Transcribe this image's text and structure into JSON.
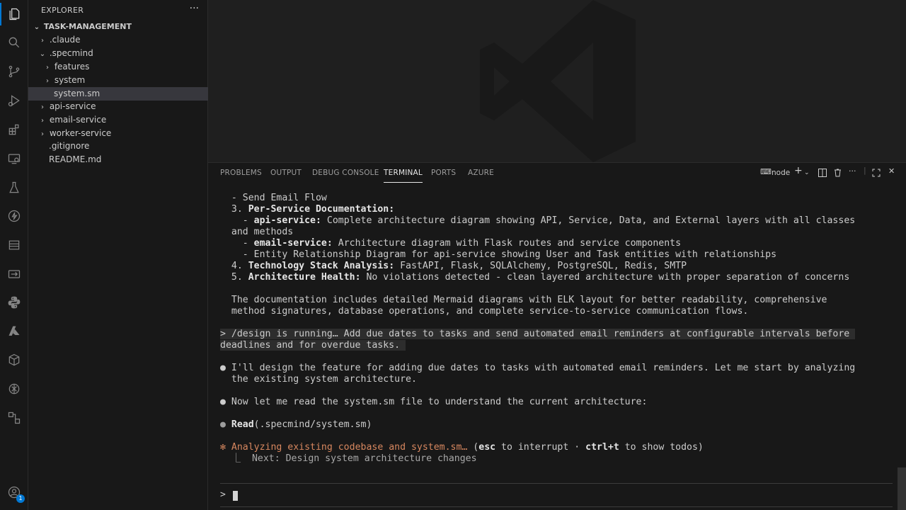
{
  "activity_bar": {
    "icons": [
      "files-icon",
      "search-icon",
      "source-control-icon",
      "run-debug-icon",
      "extensions-icon",
      "remote-explorer-icon",
      "testing-icon",
      "lightning-icon",
      "docker-icon",
      "remote-icon",
      "python-icon",
      "azure-icon",
      "package-icon",
      "openai-icon",
      "diagram-icon",
      "account-icon"
    ],
    "account_badge": "1"
  },
  "explorer": {
    "title": "EXPLORER",
    "more": "···",
    "root": "TASK-MANAGEMENT",
    "items": [
      {
        "label": ".claude",
        "kind": "folder",
        "expanded": false,
        "depth": 1
      },
      {
        "label": ".specmind",
        "kind": "folder",
        "expanded": true,
        "depth": 1
      },
      {
        "label": "features",
        "kind": "folder",
        "expanded": false,
        "depth": 2
      },
      {
        "label": "system",
        "kind": "folder",
        "expanded": false,
        "depth": 2
      },
      {
        "label": "system.sm",
        "kind": "file",
        "selected": true,
        "depth": 2
      },
      {
        "label": "api-service",
        "kind": "folder",
        "expanded": false,
        "depth": 1
      },
      {
        "label": "email-service",
        "kind": "folder",
        "expanded": false,
        "depth": 1
      },
      {
        "label": "worker-service",
        "kind": "folder",
        "expanded": false,
        "depth": 1
      },
      {
        "label": ".gitignore",
        "kind": "file",
        "depth": 1
      },
      {
        "label": "README.md",
        "kind": "file",
        "depth": 1
      }
    ]
  },
  "panel": {
    "tabs": [
      {
        "label": "PROBLEMS"
      },
      {
        "label": "OUTPUT"
      },
      {
        "label": "DEBUG CONSOLE"
      },
      {
        "label": "TERMINAL",
        "active": true
      },
      {
        "label": "PORTS"
      },
      {
        "label": "AZURE"
      }
    ],
    "terminal_name": "node"
  },
  "terminal": {
    "l1": "  - Send Email Flow",
    "l2_num": "3. ",
    "l2_bold": "Per-Service Documentation:",
    "l3_pre": "  - ",
    "l3_bold": "api-service:",
    "l3_rest": " Complete architecture diagram showing API, Service, Data, and External layers with all classes",
    "l4": "and methods",
    "l5_pre": "  - ",
    "l5_bold": "email-service:",
    "l5_rest": " Architecture diagram with Flask routes and service components",
    "l6": "  - Entity Relationship Diagram for api-service showing User and Task entities with relationships",
    "l7_num": "4. ",
    "l7_bold": "Technology Stack Analysis:",
    "l7_rest": " FastAPI, Flask, SQLAlchemy, PostgreSQL, Redis, SMTP",
    "l8_num": "5. ",
    "l8_bold": "Architecture Health:",
    "l8_rest": " No violations detected - clean layered architecture with proper separation of concerns",
    "l9": "The documentation includes detailed Mermaid diagrams with ELK layout for better readability, comprehensive",
    "l10": "method signatures, database operations, and complete service-to-service communication flows.",
    "cmd1": "> /design is running… Add due dates to tasks and send automated email reminders at configurable intervals before ",
    "cmd2": "deadlines and for overdue tasks. ",
    "a1": "I'll design the feature for adding due dates to tasks with automated email reminders. Let me start by analyzing",
    "a2": "the existing system architecture.",
    "b1": "Now let me read the system.sm file to understand the current architecture:",
    "c_bold": "Read",
    "c_rest": "(.specmind/system.sm)",
    "d_star": "✻",
    "d_text": " Analyzing existing codebase and system.sm…",
    "d_open": " (",
    "d_esc": "esc",
    "d_mid": " to interrupt · ",
    "d_ctrl": "ctrl+t",
    "d_end": " to show todos)",
    "e1": "  ⎿  Next: Design system architecture changes",
    "bullet": "●",
    "prompt": ">"
  }
}
